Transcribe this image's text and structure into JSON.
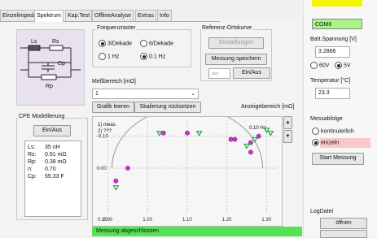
{
  "tabs": [
    "Einzelimpedanz",
    "Spektrum",
    "Kap.Test",
    "OfflineAnalyse",
    "Extras",
    "Info"
  ],
  "active_tab": "Spektrum",
  "freq": {
    "title": "Frequenzraster",
    "options": [
      "3/Dekade",
      "6/Dekade",
      "1 Hz",
      "0.1 Hz"
    ]
  },
  "ref": {
    "title": "Referenz-Ortskurve",
    "settings_btn": "Einstellungen",
    "save_btn": "Messung speichern",
    "field_value": "aus",
    "toggle_btn": "Ein/Aus"
  },
  "range": {
    "label": "Meßbereich [mΩ]",
    "value": "1"
  },
  "graph_buttons": {
    "clear": "Grafik leeren",
    "reset": "Skalierung rücksetzen"
  },
  "display_range_label": "Anzeigebereich [mΩ]",
  "circuit": {
    "ls": "Ls",
    "rs": "Rs",
    "cp": "Cp",
    "rp": "Rp"
  },
  "cpe": {
    "title": "CPE Modellierung",
    "toggle_btn": "Ein/Aus",
    "labels": [
      "Ls:",
      "Rs:",
      "Rp:",
      "n:",
      "Cp:"
    ],
    "values": [
      "35 nH",
      "0.91 mΩ",
      "0.38 mΩ",
      "0.70",
      "55.33 F"
    ]
  },
  "chart_data": {
    "type": "scatter",
    "legend": [
      "1) meas.",
      "2) ???"
    ],
    "annotation": "0.10 Hz",
    "xlim": [
      0.87,
      1.33
    ],
    "ylim": [
      -0.15,
      0.14
    ],
    "x_ticks": [
      "0.90",
      "1.00",
      "1.10",
      "1.20",
      "1.30"
    ],
    "x_tick_values": [
      0.9,
      1.0,
      1.1,
      1.2,
      1.3
    ],
    "x_tick_prefix": "0.10",
    "y_ticks": [
      "-0.10",
      "0.00"
    ],
    "y_tick_values": [
      -0.1,
      0.0
    ],
    "series": [
      {
        "points": [
          [
            0.92,
            0.04
          ],
          [
            0.95,
            0.0
          ],
          [
            1.1,
            -0.11
          ],
          [
            1.22,
            -0.09
          ],
          [
            1.26,
            -0.08
          ],
          [
            1.28,
            -0.1
          ],
          [
            1.26,
            -0.05
          ],
          [
            1.21,
            -0.09
          ],
          [
            1.04,
            -0.11
          ]
        ],
        "color": "#cc33cc",
        "marker": "circle"
      },
      {
        "points": [
          [
            1.03,
            -0.11
          ],
          [
            1.13,
            -0.11
          ],
          [
            1.27,
            -0.09
          ],
          [
            1.31,
            -0.11
          ],
          [
            1.3,
            -0.12
          ],
          [
            0.92,
            0.06
          ],
          [
            1.25,
            -0.07
          ]
        ],
        "color": "#22aa44",
        "marker": "triangle"
      }
    ],
    "fit_arc": {
      "center_x": 1.1,
      "center_y": 0.0,
      "radius": 0.19
    }
  },
  "status_text": "Messung abgeschlossen",
  "right": {
    "device": "COM6",
    "batt_label": "Batt.Spannung [V]",
    "batt_value": "3.2866",
    "volt_options": [
      "60V",
      "5V"
    ],
    "temp_label": "Temperatur [°C]",
    "temp_value": "23.3",
    "seq_title": "Messabfolge",
    "seq_options": [
      "kontinuierlich",
      "einzeln"
    ],
    "start_btn": "Start Messung",
    "log_title": "LogDatei",
    "open_btn": "öffnen"
  },
  "colors": {
    "status_green": "#55e255",
    "device_green": "#a8f48a",
    "yellow": "#f5f500",
    "pink": "#f8c8cc"
  }
}
